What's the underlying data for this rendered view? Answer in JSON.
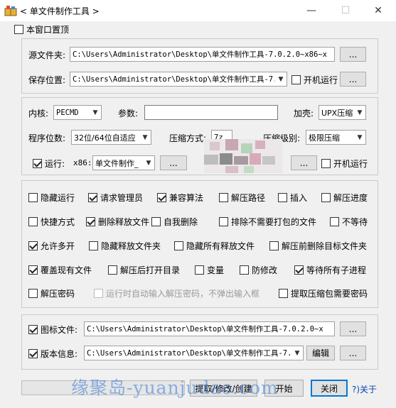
{
  "window": {
    "title": "< 单文件制作工具 >",
    "minimize": "—",
    "maximize": "☐",
    "close": "✕"
  },
  "topmost": {
    "label": "本窗口置顶",
    "checked": false
  },
  "paths": {
    "source_label": "源文件夹:",
    "source_value": "C:\\Users\\Administrator\\Desktop\\单文件制作工具-7.0.2.0~x86~x",
    "save_label": "保存位置:",
    "save_value": "C:\\Users\\Administrator\\Desktop\\单文件制作工具-7.",
    "browse": "...",
    "autostart_label": "开机运行"
  },
  "settings": {
    "kernel_label": "内核:",
    "kernel_value": "PECMD",
    "params_label": "参数:",
    "params_value": "",
    "shell_label": "加壳:",
    "shell_value": "UPX压缩",
    "bits_label": "程序位数:",
    "bits_value": "32位/64位自适应",
    "compress_method_label": "压缩方式:",
    "compress_method_value": "7z",
    "compress_level_label": "压缩级别:",
    "compress_level_value": "极限压缩",
    "run_label": "运行:",
    "run_arch": "x86:",
    "run_value": "单文件制作_",
    "browse": "...",
    "autostart_label": "开机运行"
  },
  "options": [
    {
      "label": "隐藏运行",
      "checked": false
    },
    {
      "label": "请求管理员",
      "checked": true
    },
    {
      "label": "兼容算法",
      "checked": true
    },
    {
      "label": "解压路径",
      "checked": false
    },
    {
      "label": "插入",
      "checked": false
    },
    {
      "label": "解压进度",
      "checked": false
    },
    {
      "label": "快捷方式",
      "checked": false
    },
    {
      "label": "删除释放文件",
      "checked": true
    },
    {
      "label": "自我删除",
      "checked": false
    },
    {
      "label": "排除不需要打包的文件",
      "checked": false
    },
    {
      "label": "不等待",
      "checked": false
    },
    {
      "label": "允许多开",
      "checked": true
    },
    {
      "label": "隐藏释放文件夹",
      "checked": false
    },
    {
      "label": "隐藏所有释放文件",
      "checked": false
    },
    {
      "label": "解压前删除目标文件夹",
      "checked": false
    },
    {
      "label": "覆盖现有文件",
      "checked": true
    },
    {
      "label": "解压后打开目录",
      "checked": false
    },
    {
      "label": "变量",
      "checked": false
    },
    {
      "label": "防修改",
      "checked": false
    },
    {
      "label": "等待所有子进程",
      "checked": true
    },
    {
      "label": "解压密码",
      "checked": false
    },
    {
      "label": "运行时自动输入解压密码，不弹出输入框",
      "checked": false,
      "disabled": true
    },
    {
      "label": "提取压缩包需要密码",
      "checked": false
    }
  ],
  "resources": {
    "icon_label": "图标文件:",
    "icon_checked": true,
    "icon_value": "C:\\Users\\Administrator\\Desktop\\单文件制作工具-7.0.2.0~x",
    "version_label": "版本信息:",
    "version_checked": true,
    "version_value": "C:\\Users\\Administrator\\Desktop\\单文件制作工具-7.",
    "edit": "编辑",
    "browse": "..."
  },
  "footer": {
    "extract_button": "提取/修改/创建",
    "start_button": "开始",
    "close_button": "关闭",
    "about_link": "?)关于"
  },
  "watermark": "缘聚岛-yuanjudao.com"
}
